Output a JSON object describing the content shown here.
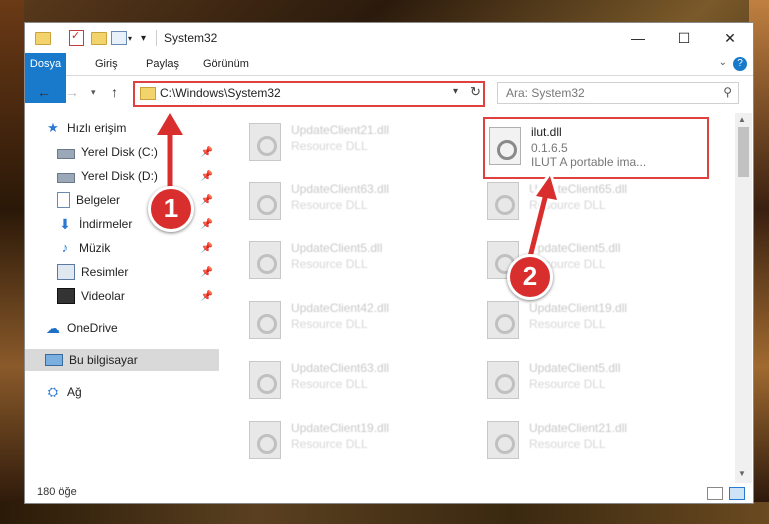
{
  "title": "System32",
  "ribbon": {
    "tabs": [
      "Dosya",
      "Giriş",
      "Paylaş",
      "Görünüm"
    ]
  },
  "address": {
    "path": "C:\\Windows\\System32"
  },
  "search": {
    "placeholder": "Ara: System32"
  },
  "nav": {
    "quick_access": "Hızlı erişim",
    "items": [
      {
        "label": "Yerel Disk (C:)",
        "icon": "disk-icon"
      },
      {
        "label": "Yerel Disk (D:)",
        "icon": "disk-icon"
      },
      {
        "label": "Belgeler",
        "icon": "documents-icon"
      },
      {
        "label": "İndirmeler",
        "icon": "downloads-icon"
      },
      {
        "label": "Müzik",
        "icon": "music-icon"
      },
      {
        "label": "Resimler",
        "icon": "pictures-icon"
      },
      {
        "label": "Videolar",
        "icon": "videos-icon"
      }
    ],
    "onedrive": "OneDrive",
    "this_pc": "Bu bilgisayar",
    "network": "Ağ"
  },
  "files": {
    "left": [
      {
        "name": "UpdateClient21.dll",
        "type": "Resource DLL"
      },
      {
        "name": "UpdateClient63.dll",
        "type": "Resource DLL"
      },
      {
        "name": "UpdateClient5.dll",
        "type": "Resource DLL"
      },
      {
        "name": "UpdateClient42.dll",
        "type": "Resource DLL"
      },
      {
        "name": "UpdateClient63.dll",
        "type": "Resource DLL"
      },
      {
        "name": "UpdateClient19.dll",
        "type": "Resource DLL"
      }
    ],
    "right": [
      {
        "name": "UpdateClient65.dll",
        "type": "Resource DLL"
      },
      {
        "name": "UpdateClient5.dll",
        "type": "Resource DLL"
      },
      {
        "name": "UpdateClient19.dll",
        "type": "Resource DLL"
      },
      {
        "name": "UpdateClient5.dll",
        "type": "Resource DLL"
      },
      {
        "name": "UpdateClient21.dll",
        "type": "Resource DLL"
      }
    ],
    "highlighted": {
      "name": "ilut.dll",
      "version": "0.1.6.5",
      "description": "ILUT A portable ima..."
    }
  },
  "status": {
    "count": "180 öğe"
  },
  "annotations": {
    "step1": "1",
    "step2": "2"
  },
  "colors": {
    "accent": "#1979ca",
    "highlight": "#e04040",
    "marker": "#d92e2e"
  }
}
